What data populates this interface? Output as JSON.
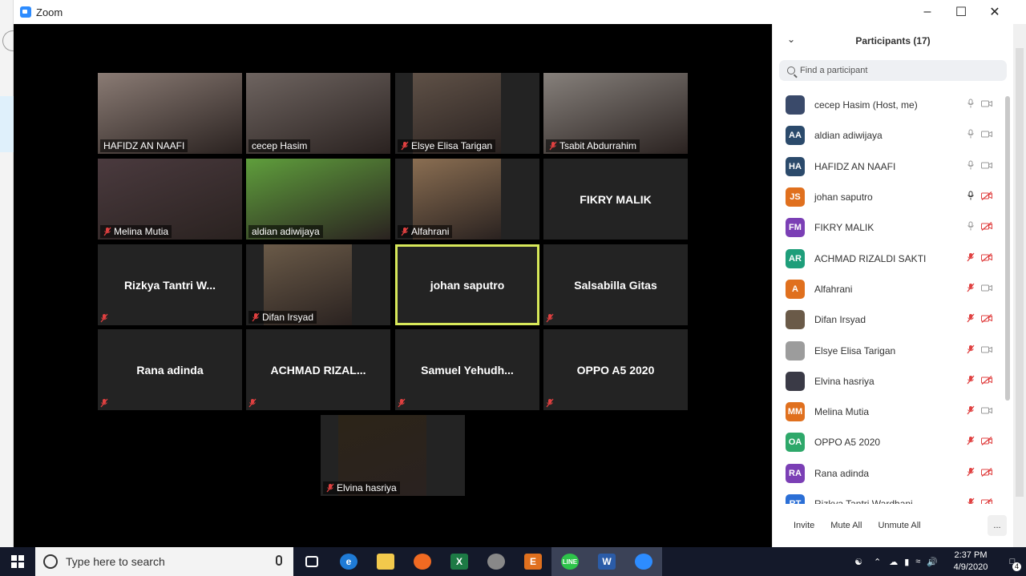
{
  "window": {
    "title": "Zoom"
  },
  "tiles": [
    {
      "name": "HAFIDZ AN NAAFI",
      "muted": false,
      "video": true,
      "bg": "#8a7b74"
    },
    {
      "name": "cecep Hasim",
      "muted": false,
      "video": true,
      "bg": "#6e6460"
    },
    {
      "name": "Elsye Elisa Tarigan",
      "muted": true,
      "video": true,
      "bg": "#5f5147"
    },
    {
      "name": "Tsabit Abdurrahim",
      "muted": true,
      "video": true,
      "bg": "#86807b"
    },
    {
      "name": "Melina Mutia",
      "muted": true,
      "video": true,
      "bg": "#4a3a3e"
    },
    {
      "name": "aldian adiwijaya",
      "muted": false,
      "video": true,
      "bg": "#5f9e3c"
    },
    {
      "name": "Alfahrani",
      "muted": true,
      "video": true,
      "bg": "#8a6e52"
    },
    {
      "name": "FIKRY MALIK",
      "muted": false,
      "video": false
    },
    {
      "name": "Rizkya Tantri W...",
      "muted": true,
      "video": false
    },
    {
      "name": "Difan Irsyad",
      "muted": true,
      "video": true,
      "bg": "#6a5a48"
    },
    {
      "name": "johan saputro",
      "muted": false,
      "video": false,
      "active": true
    },
    {
      "name": "Salsabilla Gitas",
      "muted": true,
      "video": false
    },
    {
      "name": "Rana adinda",
      "muted": true,
      "video": false
    },
    {
      "name": "ACHMAD RIZAL...",
      "muted": true,
      "video": false
    },
    {
      "name": "Samuel Yehudh...",
      "muted": true,
      "video": false
    },
    {
      "name": "OPPO A5 2020",
      "muted": true,
      "video": false
    },
    {
      "name": "Elvina hasriya",
      "muted": true,
      "video": true,
      "bg": "#2c2418"
    }
  ],
  "panel": {
    "title": "Participants (17)",
    "search_placeholder": "Find a participant",
    "participants": [
      {
        "name": "cecep Hasim (Host, me)",
        "initials": "",
        "color": "#3a4a6a",
        "mic": "on",
        "cam": "on"
      },
      {
        "name": "aldian adiwijaya",
        "initials": "AA",
        "color": "#2b4a6b",
        "mic": "on",
        "cam": "on"
      },
      {
        "name": "HAFIDZ AN NAAFI",
        "initials": "HA",
        "color": "#2b4a6b",
        "mic": "on",
        "cam": "on"
      },
      {
        "name": "johan saputro",
        "initials": "JS",
        "color": "#e0701e",
        "mic": "active",
        "cam": "off"
      },
      {
        "name": "FIKRY MALIK",
        "initials": "FM",
        "color": "#7b3fb5",
        "mic": "on",
        "cam": "off"
      },
      {
        "name": "ACHMAD RIZALDI SAKTI",
        "initials": "AR",
        "color": "#1e9e7a",
        "mic": "off",
        "cam": "off"
      },
      {
        "name": "Alfahrani",
        "initials": "A",
        "color": "#e0701e",
        "mic": "off",
        "cam": "on"
      },
      {
        "name": "Difan Irsyad",
        "initials": "",
        "color": "#6a5a48",
        "mic": "off",
        "cam": "off"
      },
      {
        "name": "Elsye Elisa Tarigan",
        "initials": "",
        "color": "#9c9c9c",
        "mic": "off",
        "cam": "on"
      },
      {
        "name": "Elvina hasriya",
        "initials": "",
        "color": "#3a3a46",
        "mic": "off",
        "cam": "off"
      },
      {
        "name": "Melina Mutia",
        "initials": "MM",
        "color": "#e0701e",
        "mic": "off",
        "cam": "on"
      },
      {
        "name": "OPPO A5 2020",
        "initials": "OA",
        "color": "#2ea86a",
        "mic": "off",
        "cam": "off"
      },
      {
        "name": "Rana adinda",
        "initials": "RA",
        "color": "#7b3fb5",
        "mic": "off",
        "cam": "off"
      },
      {
        "name": "Rizkya Tantri Wardhani",
        "initials": "RT",
        "color": "#2b6fd6",
        "mic": "off",
        "cam": "off"
      }
    ],
    "invite_label": "Invite",
    "mute_all_label": "Mute All",
    "unmute_all_label": "Unmute All",
    "more_label": "..."
  },
  "taskbar": {
    "search_placeholder": "Type here to search",
    "time": "2:37 PM",
    "date": "4/9/2020",
    "notifications": "4"
  }
}
